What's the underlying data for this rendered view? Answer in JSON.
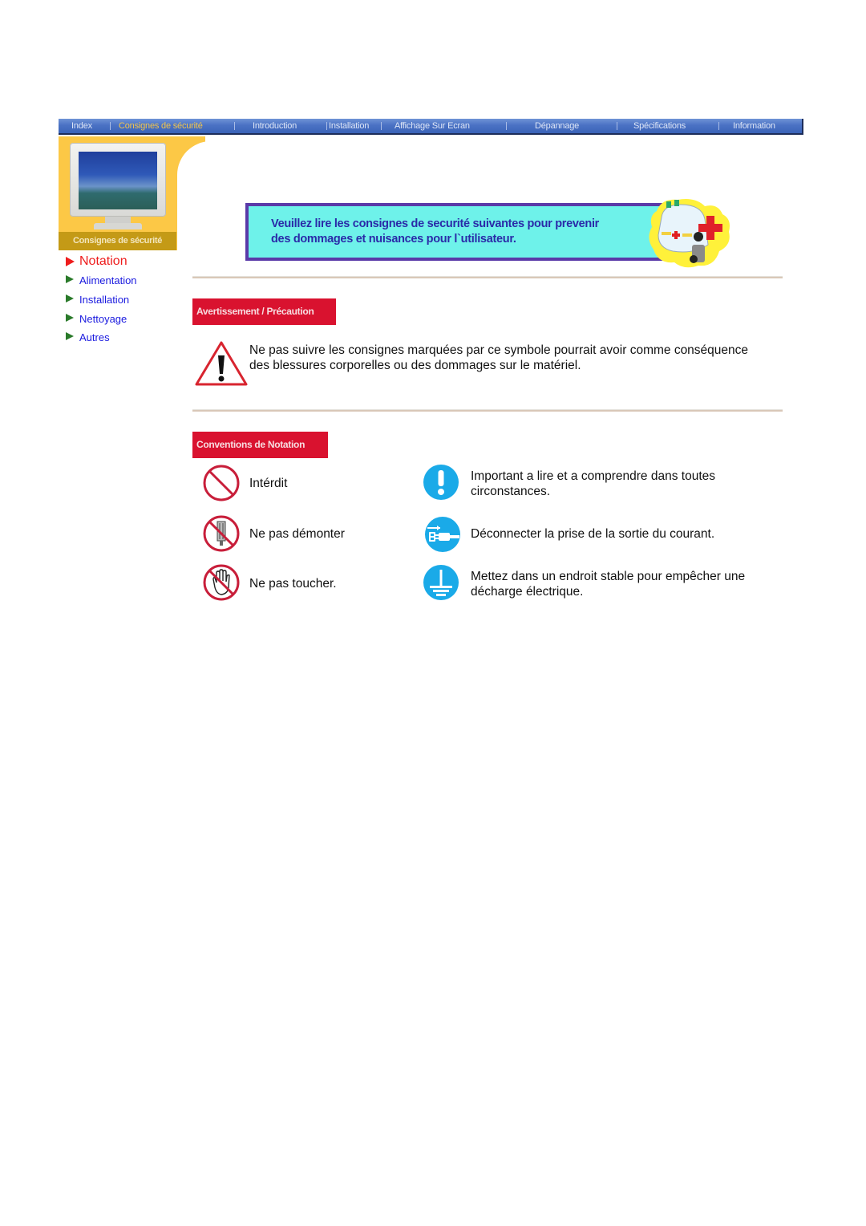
{
  "nav": {
    "items": [
      {
        "label": "Index",
        "active": false
      },
      {
        "label": "Consignes de sécurité",
        "active": true
      },
      {
        "label": "Introduction",
        "active": false
      },
      {
        "label": "Installation",
        "active": false
      },
      {
        "label": "Affichage Sur Ecran",
        "active": false
      },
      {
        "label": "Dépannage",
        "active": false
      },
      {
        "label": "Spécifications",
        "active": false
      },
      {
        "label": "Information",
        "active": false
      }
    ]
  },
  "sidebar": {
    "banner_label": "Consignes de sécurité",
    "items": [
      {
        "label": "Notation",
        "active": true
      },
      {
        "label": "Alimentation",
        "active": false
      },
      {
        "label": "Installation",
        "active": false
      },
      {
        "label": "Nettoyage",
        "active": false
      },
      {
        "label": "Autres",
        "active": false
      }
    ]
  },
  "intro": {
    "text": "Veuillez lire les consignes de securité suivantes pour prevenir\ndes dommages et nuisances pour l`utilisateur."
  },
  "warning_section": {
    "header": "Avertissement / Précaution",
    "icon": "warning-triangle-icon",
    "text": "Ne pas suivre les consignes marquées par ce symbole pourrait avoir comme conséquence\ndes blessures corporelles ou des dommages sur le matériel."
  },
  "notation_section": {
    "header": "Conventions de Notation",
    "left": [
      {
        "icon": "prohibited-icon",
        "label": "Intérdit"
      },
      {
        "icon": "no-disassembly-icon",
        "label": "Ne pas démonter"
      },
      {
        "icon": "no-touch-icon",
        "label": "Ne pas toucher."
      }
    ],
    "right": [
      {
        "icon": "important-exclamation-icon",
        "label": "Important a lire et a comprendre dans toutes\ncirconstances."
      },
      {
        "icon": "unplug-icon",
        "label": "Déconnecter la prise de la sortie du courant."
      },
      {
        "icon": "ground-icon",
        "label": "Mettez dans un endroit stable pour empêcher une\ndécharge électrique."
      }
    ]
  },
  "colors": {
    "nav_bg": "#4b72c4",
    "nav_active": "#f4c64a",
    "sidebar_yellow": "#fcc846",
    "sidebar_strip": "#c49a16",
    "active_red": "#ee1c1c",
    "link_blue": "#1a1adf",
    "header_red": "#d9122f",
    "banner_cyan": "#6ef2ea",
    "banner_border": "#5a3aa8",
    "icon_blue": "#1aaae8"
  }
}
